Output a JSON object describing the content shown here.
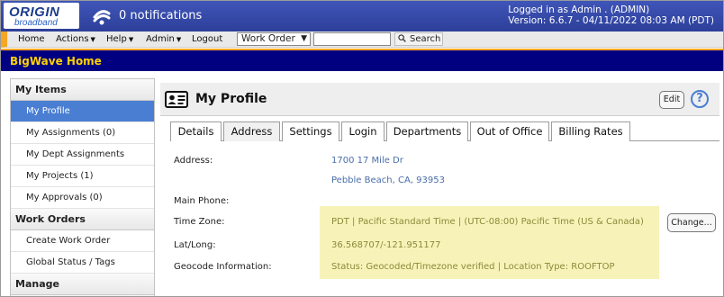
{
  "header": {
    "logo_text": "ORIGIN",
    "logo_subtext": "broadband",
    "notifications": "0 notifications",
    "login_line1": "Logged in as Admin . (ADMIN)",
    "login_line2": "Version: 6.6.7 - 04/11/2022 08:03 AM (PDT)"
  },
  "menu": {
    "items": [
      {
        "label": "Home"
      },
      {
        "label": "Actions"
      },
      {
        "label": "Help"
      },
      {
        "label": "Admin"
      },
      {
        "label": "Logout"
      }
    ],
    "search_type": "Work Order",
    "search_value": "",
    "search_button": "Search"
  },
  "page_title": "BigWave Home",
  "sidebar": {
    "sections": [
      {
        "title": "My Items",
        "items": [
          "My Profile",
          "My Assignments (0)",
          "My Dept Assignments",
          "My Projects (1)",
          "My Approvals (0)"
        ]
      },
      {
        "title": "Work Orders",
        "items": [
          "Create Work Order",
          "Global Status / Tags"
        ]
      },
      {
        "title": "Manage",
        "items": []
      }
    ],
    "active_item": "My Profile"
  },
  "profile": {
    "title": "My Profile",
    "edit_label": "Edit",
    "help_label": "?",
    "tabs": [
      "Details",
      "Address",
      "Settings",
      "Login",
      "Departments",
      "Out of Office",
      "Billing Rates"
    ],
    "active_tab": "Address",
    "fields": {
      "address_label": "Address:",
      "address_line1": "1700 17 Mile Dr",
      "address_line2": "Pebble Beach, CA, 93953",
      "phone_label": "Main Phone:",
      "phone_value": "",
      "timezone_label": "Time Zone:",
      "timezone_value": "PDT | Pacific Standard Time | (UTC-08:00) Pacific Time (US & Canada)",
      "latlong_label": "Lat/Long:",
      "latlong_value": "36.568707/-121.951177",
      "geocode_label": "Geocode Information:",
      "geocode_value": "Status: Geocoded/Timezone verified | Location Type: ROOFTOP"
    },
    "change_label": "Change..."
  },
  "colors": {
    "header_blue": "#2d3f99",
    "title_navy": "#000080",
    "title_text": "#ffd200",
    "accent_orange": "#f5a623",
    "active_item": "#4a7ed3",
    "highlight": "#f7f3b8",
    "value_blue": "#4a6ea8"
  },
  "icons": [
    "logo",
    "notification-icon",
    "search-icon",
    "id-card-icon",
    "help-icon",
    "caret-down-icon"
  ]
}
